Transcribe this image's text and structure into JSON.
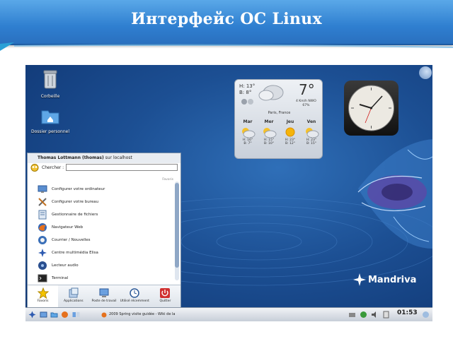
{
  "slide": {
    "title": "Интерфейс  ОС Linux"
  },
  "desktop": {
    "icons": [
      {
        "label": "Corbeille",
        "icon": "trash-icon"
      },
      {
        "label": "Dossier personnel",
        "icon": "home-folder-icon"
      }
    ]
  },
  "weather": {
    "high": "H: 13°",
    "low": "B: 8°",
    "temp": "7°",
    "wind": "4 Km/h NWO",
    "humidity": "67%",
    "city": "Paris, France",
    "days": [
      {
        "name": "Mar",
        "h": "H: 16°",
        "b": "B: 7°",
        "icon": "partly-cloudy-icon"
      },
      {
        "name": "Mer",
        "h": "H: 15°",
        "b": "B: 10°",
        "icon": "partly-cloudy-icon"
      },
      {
        "name": "Jeu",
        "h": "H: 23°",
        "b": "B: 12°",
        "icon": "sun-icon"
      },
      {
        "name": "Ven",
        "h": "H: 23°",
        "b": "B: 15°",
        "icon": "partly-cloudy-icon"
      }
    ]
  },
  "menu": {
    "user": "Thomas Lottmann (thomas)",
    "host_prefix": "sur",
    "host": "localhost",
    "search_label": "Chercher :",
    "search_value": "",
    "section": "Favoris",
    "items": [
      {
        "label": "Configurer votre ordinateur",
        "icon": "computer-config-icon"
      },
      {
        "label": "Configurer votre bureau",
        "icon": "desktop-tools-icon"
      },
      {
        "label": "Gestionnaire de fichiers",
        "icon": "file-manager-icon"
      },
      {
        "label": "Navigateur Web",
        "icon": "firefox-icon"
      },
      {
        "label": "Courrier / Nouvelles",
        "icon": "mail-icon"
      },
      {
        "label": "Centre multimédia Elisa",
        "icon": "media-center-icon"
      },
      {
        "label": "Lecteur audio",
        "icon": "audio-player-icon"
      },
      {
        "label": "Terminal",
        "icon": "terminal-icon"
      }
    ],
    "tabs": [
      {
        "label": "Favoris",
        "icon": "star-icon"
      },
      {
        "label": "Applications",
        "icon": "applications-icon"
      },
      {
        "label": "Poste de travail",
        "icon": "computer-icon"
      },
      {
        "label": "Utilisé récemment",
        "icon": "clock-icon"
      },
      {
        "label": "Quitter",
        "icon": "power-icon"
      }
    ]
  },
  "logo": {
    "text": "Mandriva"
  },
  "taskbar": {
    "task_label": "2009 Spring visite guidée - Wiki de la",
    "clock": "01:53"
  },
  "colors": {
    "banner": "#2f7fd0",
    "desktop": "#1c4f93",
    "quit": "#d03030"
  }
}
